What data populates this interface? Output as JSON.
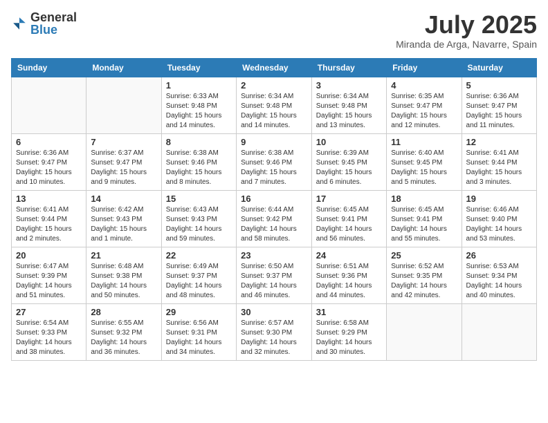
{
  "logo": {
    "text_general": "General",
    "text_blue": "Blue"
  },
  "header": {
    "month": "July 2025",
    "location": "Miranda de Arga, Navarre, Spain"
  },
  "weekdays": [
    "Sunday",
    "Monday",
    "Tuesday",
    "Wednesday",
    "Thursday",
    "Friday",
    "Saturday"
  ],
  "weeks": [
    [
      {
        "day": "",
        "info": ""
      },
      {
        "day": "",
        "info": ""
      },
      {
        "day": "1",
        "info": "Sunrise: 6:33 AM\nSunset: 9:48 PM\nDaylight: 15 hours and 14 minutes."
      },
      {
        "day": "2",
        "info": "Sunrise: 6:34 AM\nSunset: 9:48 PM\nDaylight: 15 hours and 14 minutes."
      },
      {
        "day": "3",
        "info": "Sunrise: 6:34 AM\nSunset: 9:48 PM\nDaylight: 15 hours and 13 minutes."
      },
      {
        "day": "4",
        "info": "Sunrise: 6:35 AM\nSunset: 9:47 PM\nDaylight: 15 hours and 12 minutes."
      },
      {
        "day": "5",
        "info": "Sunrise: 6:36 AM\nSunset: 9:47 PM\nDaylight: 15 hours and 11 minutes."
      }
    ],
    [
      {
        "day": "6",
        "info": "Sunrise: 6:36 AM\nSunset: 9:47 PM\nDaylight: 15 hours and 10 minutes."
      },
      {
        "day": "7",
        "info": "Sunrise: 6:37 AM\nSunset: 9:47 PM\nDaylight: 15 hours and 9 minutes."
      },
      {
        "day": "8",
        "info": "Sunrise: 6:38 AM\nSunset: 9:46 PM\nDaylight: 15 hours and 8 minutes."
      },
      {
        "day": "9",
        "info": "Sunrise: 6:38 AM\nSunset: 9:46 PM\nDaylight: 15 hours and 7 minutes."
      },
      {
        "day": "10",
        "info": "Sunrise: 6:39 AM\nSunset: 9:45 PM\nDaylight: 15 hours and 6 minutes."
      },
      {
        "day": "11",
        "info": "Sunrise: 6:40 AM\nSunset: 9:45 PM\nDaylight: 15 hours and 5 minutes."
      },
      {
        "day": "12",
        "info": "Sunrise: 6:41 AM\nSunset: 9:44 PM\nDaylight: 15 hours and 3 minutes."
      }
    ],
    [
      {
        "day": "13",
        "info": "Sunrise: 6:41 AM\nSunset: 9:44 PM\nDaylight: 15 hours and 2 minutes."
      },
      {
        "day": "14",
        "info": "Sunrise: 6:42 AM\nSunset: 9:43 PM\nDaylight: 15 hours and 1 minute."
      },
      {
        "day": "15",
        "info": "Sunrise: 6:43 AM\nSunset: 9:43 PM\nDaylight: 14 hours and 59 minutes."
      },
      {
        "day": "16",
        "info": "Sunrise: 6:44 AM\nSunset: 9:42 PM\nDaylight: 14 hours and 58 minutes."
      },
      {
        "day": "17",
        "info": "Sunrise: 6:45 AM\nSunset: 9:41 PM\nDaylight: 14 hours and 56 minutes."
      },
      {
        "day": "18",
        "info": "Sunrise: 6:45 AM\nSunset: 9:41 PM\nDaylight: 14 hours and 55 minutes."
      },
      {
        "day": "19",
        "info": "Sunrise: 6:46 AM\nSunset: 9:40 PM\nDaylight: 14 hours and 53 minutes."
      }
    ],
    [
      {
        "day": "20",
        "info": "Sunrise: 6:47 AM\nSunset: 9:39 PM\nDaylight: 14 hours and 51 minutes."
      },
      {
        "day": "21",
        "info": "Sunrise: 6:48 AM\nSunset: 9:38 PM\nDaylight: 14 hours and 50 minutes."
      },
      {
        "day": "22",
        "info": "Sunrise: 6:49 AM\nSunset: 9:37 PM\nDaylight: 14 hours and 48 minutes."
      },
      {
        "day": "23",
        "info": "Sunrise: 6:50 AM\nSunset: 9:37 PM\nDaylight: 14 hours and 46 minutes."
      },
      {
        "day": "24",
        "info": "Sunrise: 6:51 AM\nSunset: 9:36 PM\nDaylight: 14 hours and 44 minutes."
      },
      {
        "day": "25",
        "info": "Sunrise: 6:52 AM\nSunset: 9:35 PM\nDaylight: 14 hours and 42 minutes."
      },
      {
        "day": "26",
        "info": "Sunrise: 6:53 AM\nSunset: 9:34 PM\nDaylight: 14 hours and 40 minutes."
      }
    ],
    [
      {
        "day": "27",
        "info": "Sunrise: 6:54 AM\nSunset: 9:33 PM\nDaylight: 14 hours and 38 minutes."
      },
      {
        "day": "28",
        "info": "Sunrise: 6:55 AM\nSunset: 9:32 PM\nDaylight: 14 hours and 36 minutes."
      },
      {
        "day": "29",
        "info": "Sunrise: 6:56 AM\nSunset: 9:31 PM\nDaylight: 14 hours and 34 minutes."
      },
      {
        "day": "30",
        "info": "Sunrise: 6:57 AM\nSunset: 9:30 PM\nDaylight: 14 hours and 32 minutes."
      },
      {
        "day": "31",
        "info": "Sunrise: 6:58 AM\nSunset: 9:29 PM\nDaylight: 14 hours and 30 minutes."
      },
      {
        "day": "",
        "info": ""
      },
      {
        "day": "",
        "info": ""
      }
    ]
  ]
}
